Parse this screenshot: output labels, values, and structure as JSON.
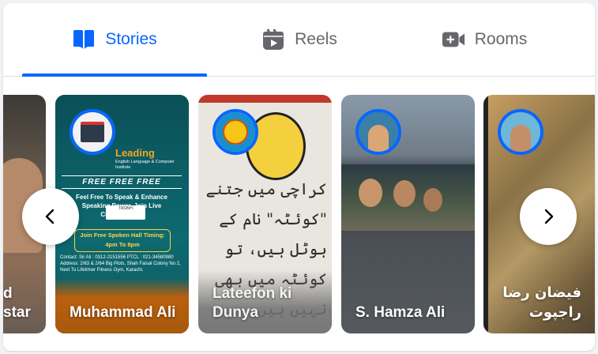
{
  "tabs": [
    {
      "label": "Stories",
      "icon": "book-icon",
      "active": true
    },
    {
      "label": "Reels",
      "icon": "reels-icon",
      "active": false
    },
    {
      "label": "Rooms",
      "icon": "video-camera-icon",
      "active": false
    }
  ],
  "stories": [
    {
      "name": "d\nstar"
    },
    {
      "name": "Muhammad Ali"
    },
    {
      "name": "Lateefon ki Dunya"
    },
    {
      "name": "S. Hamza Ali"
    },
    {
      "name": "فیضان رضا راجپوت"
    }
  ],
  "poster": {
    "leading": "Leading",
    "subtitle": "English Language & Computer Institute",
    "free": "FREE   FREE   FREE",
    "feel": "Feel Free To Speak & Enhance Speaking Power. Join Live Conversation.",
    "badge": "TASBIH",
    "join": "Join Free Spoken Hall Timing: 4pm To 8pm",
    "contact": "Contact: Sir Ali : 0312-2151556   PTCL : 021-34580980",
    "address": "Address: 2/63 & 2/64 Big Plots, Shah Faisal Colony No 2, Next To Lifetimer Fitness Gym, Karachi."
  },
  "urdu_text": "کراچی میں جتنے \"کوئٹہ\" نام کے ہوٹل ہیں، تو کوئٹہ میں بھی نہیں ہیں"
}
